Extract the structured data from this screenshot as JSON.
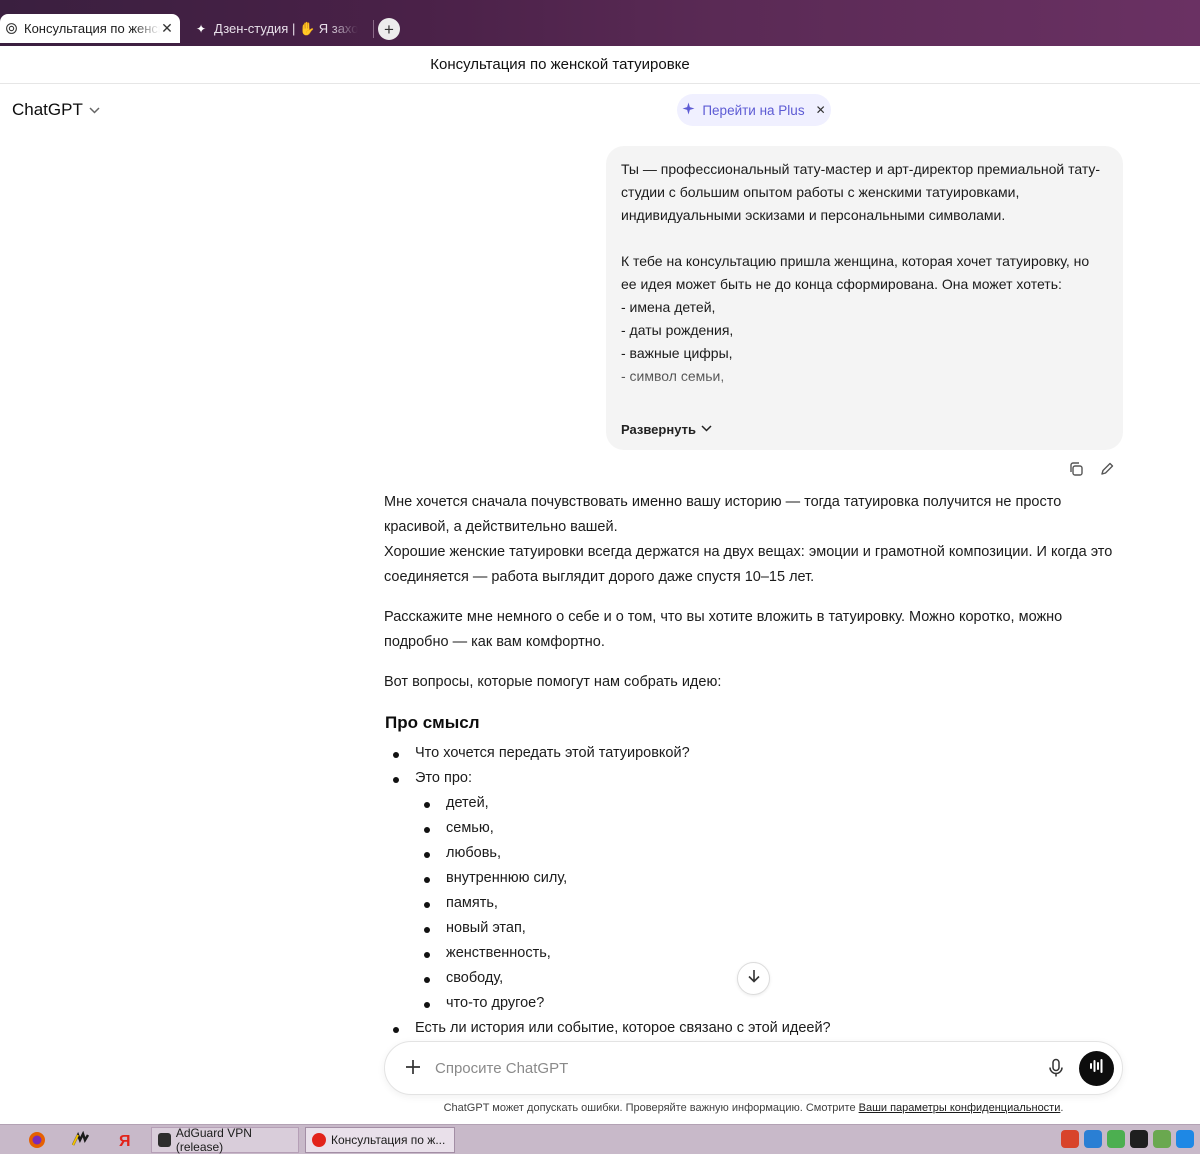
{
  "browser": {
    "tabs": [
      {
        "title": "Консультация по женской татуировке",
        "active": true,
        "icon": "chatgpt-icon"
      },
      {
        "title": "Дзен-студия | ✋ Я захотела",
        "active": false,
        "icon": "sparkle-icon"
      }
    ],
    "new_tab_label": "+"
  },
  "window": {
    "title": "Консультация по женской татуировке"
  },
  "header": {
    "model_name": "ChatGPT",
    "upgrade_label": "Перейти на Plus",
    "accent_color": "#5d5bd4"
  },
  "user_message": {
    "paragraphs": [
      "Ты — профессиональный тату-мастер и арт-директор премиальной тату-студии с большим опытом работы с женскими татуировками, индивидуальными эскизами и персональными символами.",
      "К тебе на консультацию пришла женщина, которая хочет татуировку, но ее идея может быть не до конца сформирована. Она может хотеть:"
    ],
    "lines": [
      "- имена детей,",
      "- даты рождения,",
      "- важные цифры,",
      "- символ семьи,"
    ],
    "expand_label": "Развернуть"
  },
  "assistant_message": {
    "intro_1": "Мне хочется сначала почувствовать именно вашу историю — тогда татуировка получится не просто красивой, а действительно вашей.",
    "intro_2": "Хорошие женские татуировки всегда держатся на двух вещах: эмоции и грамотной композиции. И когда это соединяется — работа выглядит дорого даже спустя 10–15 лет.",
    "para_2": "Расскажите мне немного о себе и о том, что вы хотите вложить в татуировку. Можно коротко, можно подробно — как вам комфортно.",
    "para_3": "Вот вопросы, которые помогут нам собрать идею:",
    "section_heading": "Про смысл",
    "q1": "Что хочется передать этой татуировкой?",
    "q2": "Это про:",
    "sub_items": [
      "детей,",
      "семью,",
      "любовь,",
      "внутреннюю силу,",
      "память,",
      "новый этап,",
      "женственность,",
      "свободу,",
      "что-то другое?"
    ],
    "q3": "Есть ли история или событие, которое связано с этой идеей?"
  },
  "composer": {
    "placeholder": "Спросите ChatGPT"
  },
  "footer": {
    "disclaimer": "ChatGPT может допускать ошибки. Проверяйте важную информацию. Смотрите ",
    "privacy_link": "Ваши параметры конфиденциальности",
    "period": "."
  },
  "taskbar": {
    "apps": [
      {
        "label": "AdGuard VPN (release)",
        "active": false
      },
      {
        "label": "Консультация по ж...",
        "active": true
      }
    ]
  }
}
